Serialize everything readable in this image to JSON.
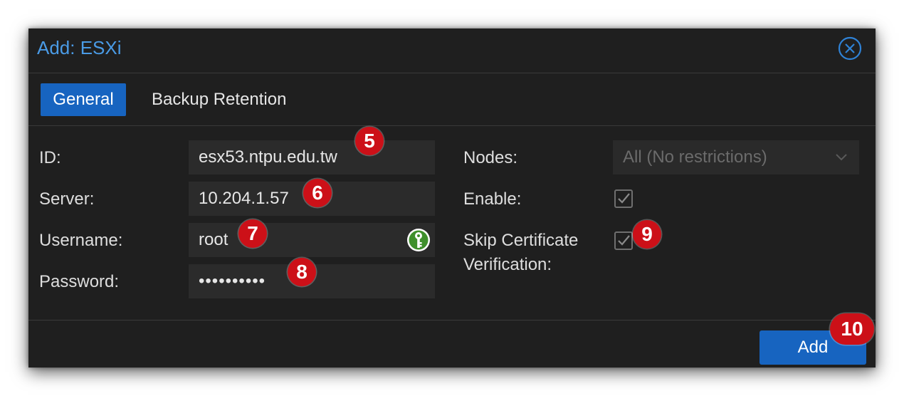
{
  "dialog": {
    "title": "Add: ESXi",
    "close_icon": "close-circle-icon"
  },
  "tabs": [
    {
      "label": "General",
      "active": true
    },
    {
      "label": "Backup Retention",
      "active": false
    }
  ],
  "form_left": {
    "id": {
      "label": "ID:",
      "value": "esx53.ntpu.edu.tw"
    },
    "server": {
      "label": "Server:",
      "value": "10.204.1.57"
    },
    "username": {
      "label": "Username:",
      "value": "root",
      "icon": "key-icon"
    },
    "password": {
      "label": "Password:",
      "value": "••••••••••"
    }
  },
  "form_right": {
    "nodes": {
      "label": "Nodes:",
      "value": "All (No restrictions)",
      "disabled": true
    },
    "enable": {
      "label": "Enable:",
      "checked": true
    },
    "skip_cert": {
      "label_line1": "Skip Certificate",
      "label_line2": "Verification:",
      "checked": true
    }
  },
  "annotations": [
    "5",
    "6",
    "7",
    "8",
    "9",
    "10"
  ],
  "footer": {
    "add_label": "Add"
  },
  "colors": {
    "accent": "#1764c0",
    "title": "#4a9be6",
    "badge": "#cc1018",
    "background": "#1f1f1f"
  }
}
